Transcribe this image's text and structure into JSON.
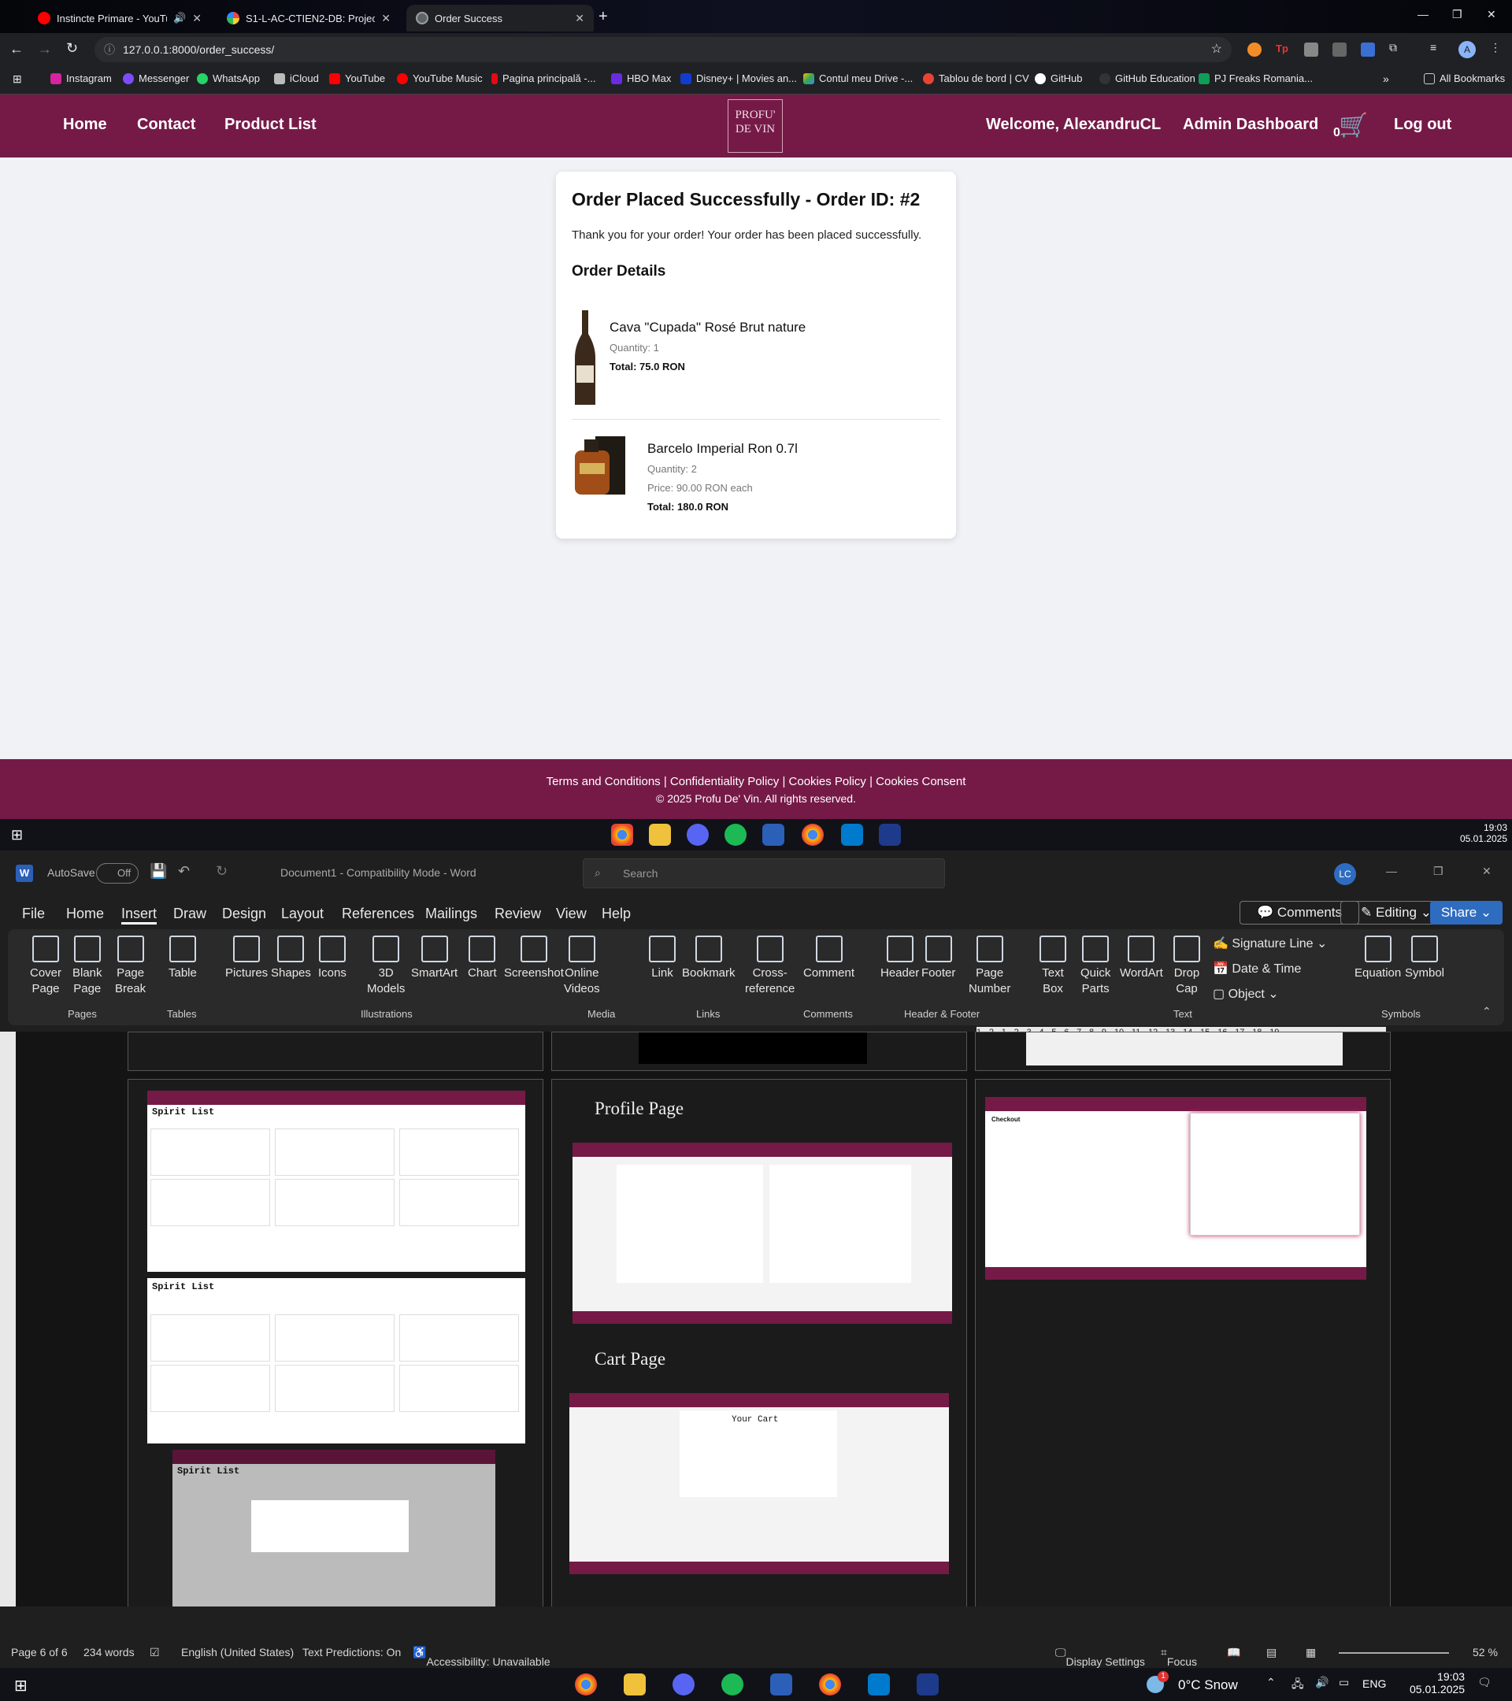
{
  "browser": {
    "tabs": [
      {
        "title": "Instincte Primare - YouTube",
        "active": false
      },
      {
        "title": "S1-L-AC-CTIEN2-DB: Project up",
        "active": false
      },
      {
        "title": "Order Success",
        "active": true
      }
    ],
    "url": "127.0.0.1:8000/order_success/",
    "bookmarks": [
      "Instagram",
      "Messenger",
      "WhatsApp",
      "iCloud",
      "YouTube",
      "YouTube Music",
      "Pagina principală -...",
      "HBO Max",
      "Disney+ | Movies an...",
      "Contul meu Drive -...",
      "Tablou de bord | CV",
      "GitHub",
      "GitHub Education",
      "PJ Freaks Romania..."
    ],
    "all_bookmarks": "All Bookmarks"
  },
  "site": {
    "nav": {
      "home": "Home",
      "contact": "Contact",
      "product_list": "Product List",
      "welcome": "Welcome, AlexandruCL",
      "admin": "Admin Dashboard",
      "cart_count": "0",
      "logout": "Log out"
    },
    "logo": {
      "line1": "PROFU'",
      "line2": "DE VIN"
    },
    "order": {
      "title": "Order Placed Successfully - Order ID: #2",
      "thanks": "Thank you for your order! Your order has been placed successfully.",
      "details_heading": "Order Details",
      "items": [
        {
          "name": "Cava \"Cupada\" Rosé Brut nature",
          "quantity": "Quantity: 1",
          "total": "Total: 75.0 RON"
        },
        {
          "name": "Barcelo Imperial Ron 0.7l",
          "quantity": "Quantity: 2",
          "price": "Price: 90.00 RON each",
          "total": "Total: 180.0 RON"
        }
      ]
    },
    "footer": {
      "links": "Terms and Conditions  |  Confidentiality Policy  |  Cookies Policy  |  Cookies Consent",
      "copyright": "© 2025 Profu De' Vin. All rights reserved."
    }
  },
  "taskbar_top": {
    "time": "19:03",
    "date": "05.01.2025"
  },
  "word": {
    "autosave": "AutoSave",
    "autosave_state": "Off",
    "doc_title": "Document1  -  Compatibility Mode  -  Word",
    "search": "Search",
    "user_initials": "LC",
    "menu": [
      "File",
      "Home",
      "Insert",
      "Draw",
      "Design",
      "Layout",
      "References",
      "Mailings",
      "Review",
      "View",
      "Help"
    ],
    "comments_btn": "Comments",
    "editing_btn": "Editing",
    "share_btn": "Share",
    "ribbon": [
      {
        "label": "Cover\nPage"
      },
      {
        "label": "Blank\nPage"
      },
      {
        "label": "Page\nBreak"
      },
      {
        "label": "Table"
      },
      {
        "label": "Pictures"
      },
      {
        "label": "Shapes"
      },
      {
        "label": "Icons"
      },
      {
        "label": "3D\nModels"
      },
      {
        "label": "SmartArt"
      },
      {
        "label": "Chart"
      },
      {
        "label": "Screenshot"
      },
      {
        "label": "Online\nVideos"
      },
      {
        "label": "Link"
      },
      {
        "label": "Bookmark"
      },
      {
        "label": "Cross-\nreference"
      },
      {
        "label": "Comment"
      },
      {
        "label": "Header"
      },
      {
        "label": "Footer"
      },
      {
        "label": "Page\nNumber"
      },
      {
        "label": "Text\nBox"
      },
      {
        "label": "Quick\nParts"
      },
      {
        "label": "WordArt"
      },
      {
        "label": "Drop\nCap"
      },
      {
        "label": "Equation"
      },
      {
        "label": "Symbol"
      }
    ],
    "text_side": [
      "Signature Line",
      "Date & Time",
      "Object"
    ],
    "groups": [
      "Pages",
      "Tables",
      "Illustrations",
      "Media",
      "Links",
      "Comments",
      "Header & Footer",
      "Text",
      "Symbols"
    ],
    "ruler": "1 · 2 · 1 · 2 · 3 · 4 · 5 · 6 · 7 · 8 · 9 · 10 · 11 · 12 · 13 · 14 · 15 · 16 · 17 · 18 · 19",
    "page_headings": {
      "profile": "Profile Page",
      "cart": "Cart Page"
    },
    "thumb_texts": {
      "spirit_list": "Spirit List",
      "your_cart": "Your Cart",
      "checkout": "Checkout"
    },
    "status": {
      "page": "Page 6 of 6",
      "words": "234 words",
      "language": "English (United States)",
      "predictions": "Text Predictions: On",
      "accessibility": "Accessibility: Unavailable",
      "display": "Display Settings",
      "focus": "Focus",
      "zoom": "52 %"
    }
  },
  "taskbar_bottom": {
    "weather": "0°C  Snow",
    "lang": "ENG",
    "time": "19:03",
    "date": "05.01.2025",
    "badge": "1"
  }
}
